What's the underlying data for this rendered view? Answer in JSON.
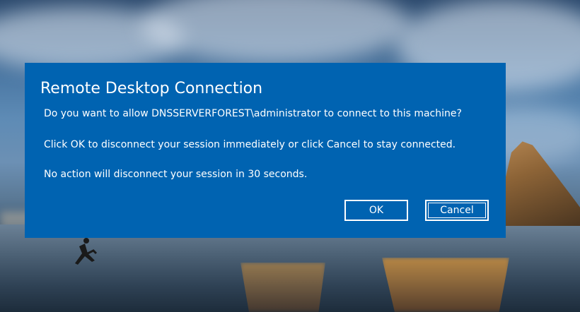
{
  "dialog": {
    "title": "Remote Desktop Connection",
    "line1": "Do you want to allow DNSSERVERFOREST\\administrator to connect to this machine?",
    "line2": "Click OK to disconnect your session immediately or click Cancel to stay connected.",
    "line3": "No action will disconnect your session in 30 seconds.",
    "ok_label": "OK",
    "cancel_label": "Cancel"
  },
  "colors": {
    "dialog_bg": "#0063b1",
    "text": "#ffffff"
  },
  "background": {
    "image": "beach-wallpaper"
  }
}
